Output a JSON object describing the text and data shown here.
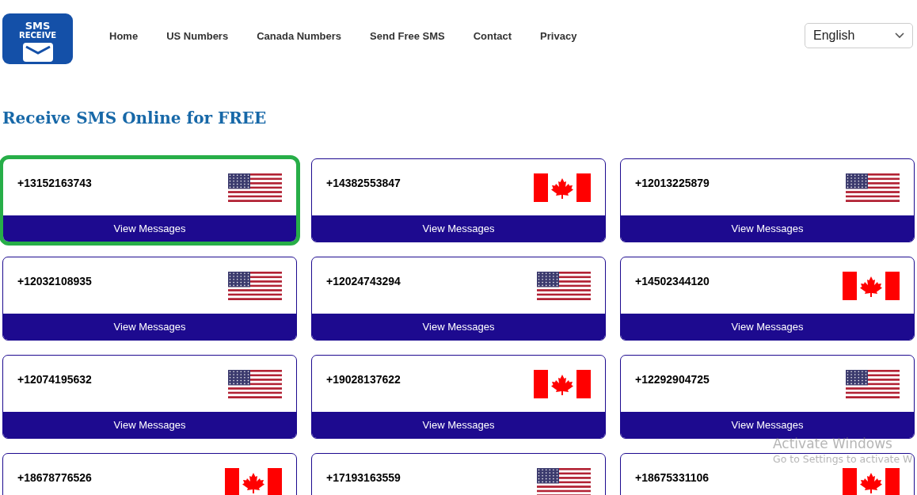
{
  "logo": {
    "line_1": "SMS",
    "line_2": "RECEIVE"
  },
  "nav": [
    {
      "label": "Home"
    },
    {
      "label": "US Numbers"
    },
    {
      "label": "Canada Numbers"
    },
    {
      "label": "Send Free SMS"
    },
    {
      "label": "Contact"
    },
    {
      "label": "Privacy"
    }
  ],
  "language_select": {
    "value": "English"
  },
  "heading": "Receive SMS Online for FREE",
  "numbers": [
    {
      "number": "+13152163743",
      "kind": "us",
      "selected": true,
      "button": "View Messages"
    },
    {
      "number": "+14382553847",
      "kind": "ca",
      "selected": false,
      "button": "View Messages"
    },
    {
      "number": "+12013225879",
      "kind": "us",
      "selected": false,
      "button": "View Messages"
    },
    {
      "number": "+12032108935",
      "kind": "us",
      "selected": false,
      "button": "View Messages"
    },
    {
      "number": "+12024743294",
      "kind": "us",
      "selected": false,
      "button": "View Messages"
    },
    {
      "number": "+14502344120",
      "kind": "ca",
      "selected": false,
      "button": "View Messages"
    },
    {
      "number": "+12074195632",
      "kind": "us",
      "selected": false,
      "button": "View Messages"
    },
    {
      "number": "+19028137622",
      "kind": "ca",
      "selected": false,
      "button": "View Messages"
    },
    {
      "number": "+12292904725",
      "kind": "us",
      "selected": false,
      "button": "View Messages"
    },
    {
      "number": "+18678776526",
      "kind": "ca",
      "selected": false
    },
    {
      "number": "+17193163559",
      "kind": "us",
      "selected": false
    },
    {
      "number": "+18675331106",
      "kind": "ca",
      "selected": false
    }
  ],
  "os_notice": {
    "title": "Activate Windows",
    "text": "Go to Settings to activate W"
  }
}
